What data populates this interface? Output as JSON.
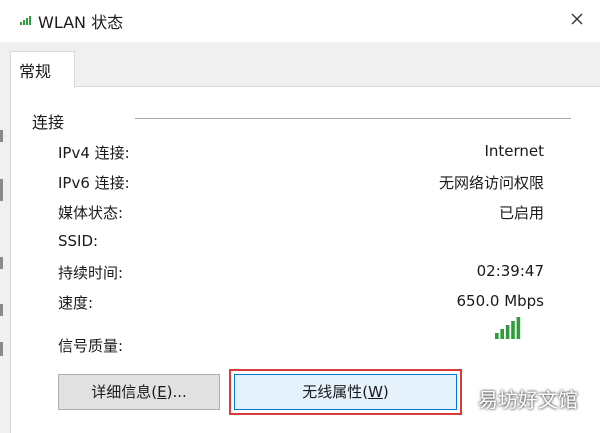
{
  "window": {
    "title": "WLAN 状态",
    "icon": "wifi-signal-icon"
  },
  "tabs": [
    {
      "label": "常规",
      "selected": true
    }
  ],
  "connection": {
    "group_label": "连接",
    "rows": [
      {
        "label": "IPv4 连接:",
        "value": "Internet"
      },
      {
        "label": "IPv6 连接:",
        "value": "无网络访问权限"
      },
      {
        "label": "媒体状态:",
        "value": "已启用"
      },
      {
        "label": "SSID:",
        "value": ""
      },
      {
        "label": "持续时间:",
        "value": "02:39:47"
      },
      {
        "label": "速度:",
        "value": "650.0 Mbps"
      },
      {
        "label": "信号质量:",
        "value": ""
      }
    ],
    "signal_quality": {
      "bars_lit": 5,
      "bars_total": 5,
      "color": "#2e9e3a"
    }
  },
  "buttons": {
    "details": {
      "text": "详细信息(",
      "mnemonic": "E",
      "suffix": ")..."
    },
    "wireless_properties": {
      "text": "无线属性(",
      "mnemonic": "W",
      "suffix": ")",
      "highlighted": true
    }
  },
  "watermark": "易坊好文馆",
  "colors": {
    "highlight_border": "#d93a3a",
    "focus_border": "#0078d7",
    "signal_green": "#2e9e3a"
  }
}
